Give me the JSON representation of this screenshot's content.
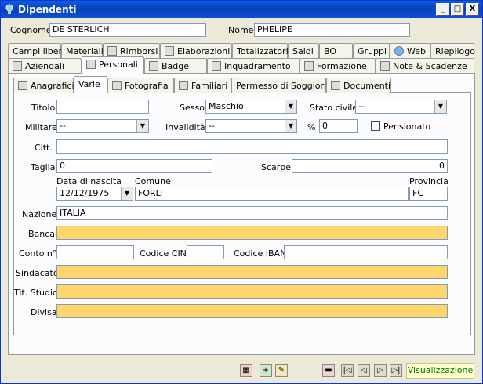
{
  "window": {
    "title": "Dipendenti",
    "btn_min": "_",
    "btn_max": "□",
    "btn_close": "X"
  },
  "header": {
    "cognome_label": "Cognome",
    "cognome_value": "DE STERLICH",
    "nome_label": "Nome",
    "nome_value": "PHELIPE"
  },
  "tabs_row1": [
    "Campi liberi",
    "Materiali",
    "Rimborsi",
    "Elaborazioni",
    "Totalizzatori",
    "Saldi",
    "BO",
    "Gruppi",
    "Web",
    "Riepilogo"
  ],
  "tabs_row2": [
    "Aziendali",
    "Personali",
    "Badge",
    "Inquadramento",
    "Formazione",
    "Note & Scadenze"
  ],
  "tabs_row3": [
    "Anagrafici",
    "Varie",
    "Fotografia",
    "Familiari",
    "Permesso di Soggiorno",
    "Documenti"
  ],
  "form": {
    "titolo_label": "Titolo",
    "titolo_value": "",
    "sesso_label": "Sesso",
    "sesso_value": "Maschio",
    "stato_civile_label": "Stato civile",
    "stato_civile_value": "--",
    "militare_label": "Militare",
    "militare_value": "--",
    "invalidita_label": "Invalidità",
    "invalidita_value": "--",
    "percent_label": "%",
    "percent_value": "0",
    "pensionato_label": "Pensionato",
    "citt_label": "Citt.",
    "citt_value": "",
    "taglia_label": "Taglia",
    "taglia_value": "0",
    "scarpe_label": "Scarpe",
    "scarpe_value": "0",
    "data_nascita_label": "Data di nascita",
    "data_nascita_value": "12/12/1975",
    "comune_label": "Comune",
    "comune_value": "FORLI",
    "provincia_label": "Provincia",
    "provincia_value": "FC",
    "nazione_label": "Nazione",
    "nazione_value": "ITALIA",
    "banca_label": "Banca",
    "banca_value": "",
    "conto_label": "Conto n°",
    "conto_value": "",
    "cin_label": "Codice CIN",
    "cin_value": "",
    "iban_label": "Codice IBAN",
    "iban_value": "",
    "sindacato_label": "Sindacato",
    "sindacato_value": "",
    "tit_studio_label": "Tit. Studio",
    "tit_studio_value": "",
    "divisa_label": "Divisa",
    "divisa_value": ""
  },
  "status": {
    "mode": "Visualizzazione"
  },
  "colors": {
    "required_field": "#ffd66b",
    "title_bar": "#0842b8"
  }
}
